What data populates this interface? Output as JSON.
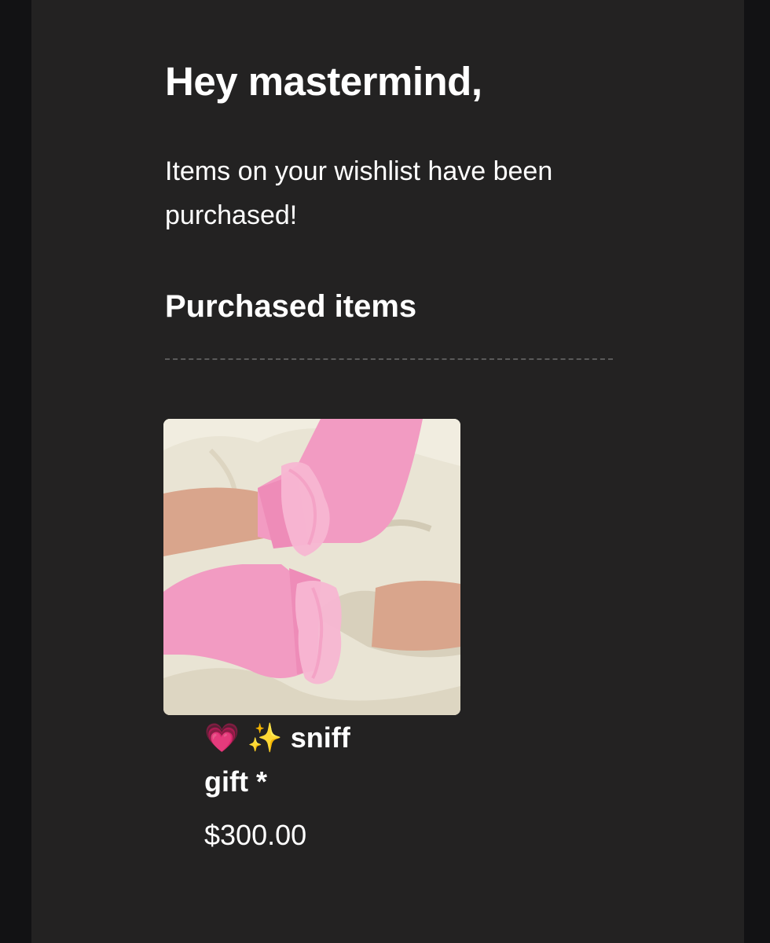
{
  "email": {
    "greeting": "Hey mastermind,",
    "message": "Items on your wishlist have been purchased!",
    "section_title": "Purchased items"
  },
  "purchased_items": [
    {
      "emoji_heart": "💗",
      "emoji_sparkles": "✨",
      "name_text": "sniff gift *",
      "price": "$300.00",
      "image_description_icon": "photo-pink-ruffle-socks"
    }
  ],
  "colors": {
    "page_background": "#121214",
    "panel_background": "#232222",
    "text": "#ffffff",
    "divider": "#5a5a5a"
  }
}
